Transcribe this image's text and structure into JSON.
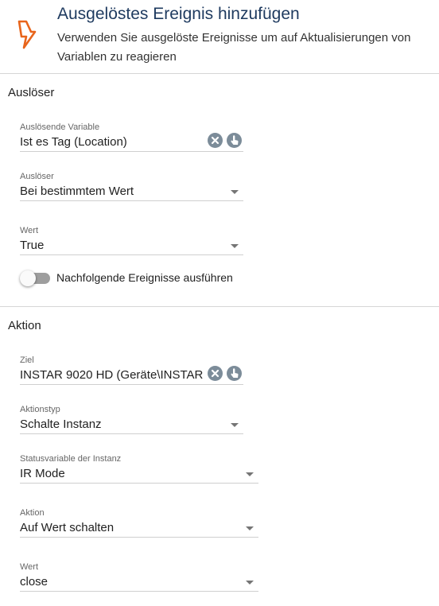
{
  "header": {
    "title": "Ausgelöstes Ereignis hinzufügen",
    "description": "Verwenden Sie ausgelöste Ereignisse um auf Aktualisierungen von Variablen zu reagieren",
    "icon": "lightning-bolt-icon",
    "accent_color": "#e8651c"
  },
  "trigger_section": {
    "title": "Auslöser",
    "variable": {
      "label": "Auslösende Variable",
      "value": "Ist es Tag (Location)"
    },
    "trigger": {
      "label": "Auslöser",
      "value": "Bei bestimmtem Wert"
    },
    "wert": {
      "label": "Wert",
      "value": "True"
    },
    "toggle": {
      "label": "Nachfolgende Ereignisse ausführen",
      "checked": false
    }
  },
  "action_section": {
    "title": "Aktion",
    "ziel": {
      "label": "Ziel",
      "value": "INSTAR 9020 HD (Geräte\\INSTAR"
    },
    "aktionstyp": {
      "label": "Aktionstyp",
      "value": "Schalte Instanz"
    },
    "statusvariable": {
      "label": "Statusvariable der Instanz",
      "value": "IR Mode"
    },
    "aktion": {
      "label": "Aktion",
      "value": "Auf Wert schalten"
    },
    "wert": {
      "label": "Wert",
      "value": "close"
    }
  }
}
